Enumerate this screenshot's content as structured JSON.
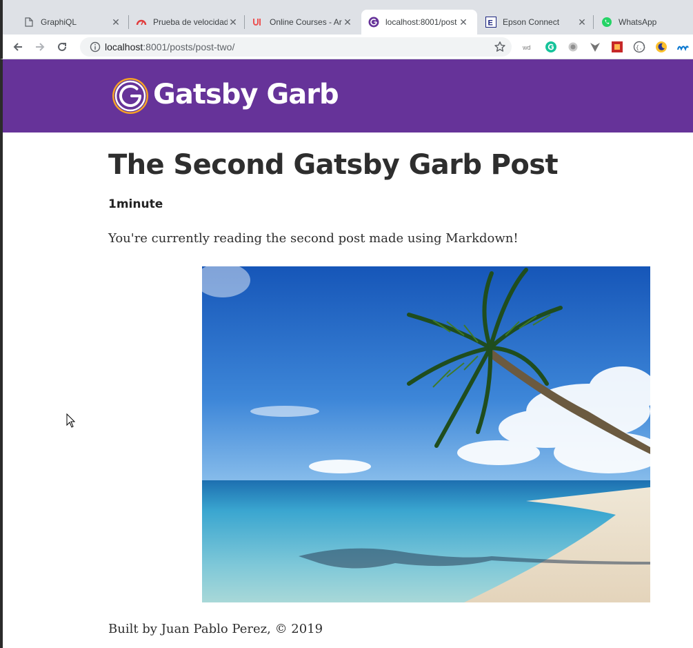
{
  "browser": {
    "tabs": [
      {
        "title": "GraphiQL",
        "icon": "document-icon",
        "active": false
      },
      {
        "title": "Prueba de velocidad",
        "icon": "speedometer-icon",
        "active": false
      },
      {
        "title": "Online Courses - Ar",
        "icon": "udemy-icon",
        "active": false
      },
      {
        "title": "localhost:8001/post",
        "icon": "gatsby-icon",
        "active": true
      },
      {
        "title": "Epson Connect",
        "icon": "epson-icon",
        "active": false
      },
      {
        "title": "WhatsApp",
        "icon": "whatsapp-icon",
        "active": false
      }
    ],
    "address": {
      "host": "localhost",
      "rest": ":8001/posts/post-two/"
    },
    "extensions": [
      "reader-icon",
      "grammarly-icon",
      "circle-extension-icon",
      "vpn-icon",
      "puzzle-extension-icon",
      "code-brackets-icon",
      "moon-icon",
      "movistar-icon"
    ]
  },
  "site": {
    "title": "Gatsby Garb",
    "brand_color": "#663399",
    "logo_accent": "#f6a325"
  },
  "post": {
    "title": "The Second Gatsby Garb Post",
    "read_time": "1minute",
    "body": "You're currently reading the second post made using Markdown!",
    "image_subject": "tropical-beach-with-palm-tree"
  },
  "footer": {
    "text": "Built by Juan Pablo Perez, © 2019"
  }
}
